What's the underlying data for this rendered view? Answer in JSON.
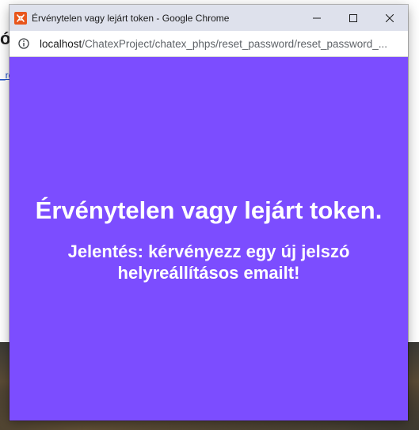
{
  "background_page": {
    "heading_fragment": "ó",
    "link_fragment": "_re"
  },
  "window": {
    "title": "Érvénytelen vagy lejárt token - Google Chrome",
    "app_icon": "xampp-icon",
    "controls": {
      "minimize": "minimize-icon",
      "maximize": "maximize-icon",
      "close": "close-icon"
    }
  },
  "address_bar": {
    "info_icon": "info-icon",
    "url_host": "localhost",
    "url_path": "/ChatexProject/chatex_phps/reset_password/reset_password_..."
  },
  "content": {
    "title": "Érvénytelen vagy lejárt token.",
    "message": "Jelentés: kérvényezz egy új jelszó helyreállításos emailt!",
    "background_color": "#7c4dff",
    "text_color": "#ffffff"
  }
}
